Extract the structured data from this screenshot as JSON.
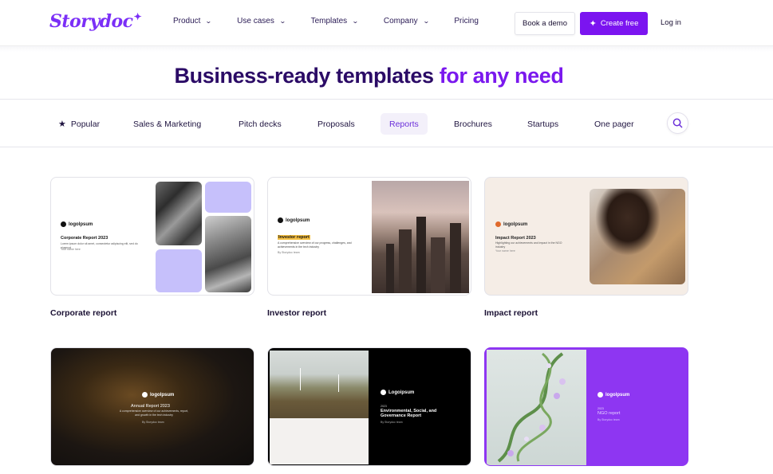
{
  "nav": {
    "logo": "Storydoc",
    "menu": [
      {
        "label": "Product",
        "has_dropdown": true
      },
      {
        "label": "Use cases",
        "has_dropdown": true
      },
      {
        "label": "Templates",
        "has_dropdown": true
      },
      {
        "label": "Company",
        "has_dropdown": true
      },
      {
        "label": "Pricing",
        "has_dropdown": false
      }
    ],
    "book_demo": "Book a demo",
    "create_free": "Create free",
    "login": "Log in"
  },
  "headline": {
    "main": "Business-ready templates ",
    "accent": "for any need"
  },
  "categories": [
    {
      "label": "Popular",
      "icon": "star-icon",
      "active": false
    },
    {
      "label": "Sales & Marketing",
      "active": false
    },
    {
      "label": "Pitch decks",
      "active": false
    },
    {
      "label": "Proposals",
      "active": false
    },
    {
      "label": "Reports",
      "active": true
    },
    {
      "label": "Brochures",
      "active": false
    },
    {
      "label": "Startups",
      "active": false
    },
    {
      "label": "One pager",
      "active": false
    }
  ],
  "search_icon": "search-icon",
  "templates": [
    {
      "title": "Corporate report",
      "preview": {
        "logo": "logolpsum",
        "heading": "Corporate Report 2023",
        "body": "Lorem ipsum dolor sit amet, consectetur adipiscing elit, sed do eiusmod",
        "meta": "Your name here"
      }
    },
    {
      "title": "Investor report",
      "preview": {
        "logo": "logolpsum",
        "heading": "Investor report",
        "body": "A comprehensive overview of our progress, challenges, and achievements in the tech industry",
        "meta": "By Storydoc team"
      }
    },
    {
      "title": "Impact report",
      "preview": {
        "logo": "logolpsum",
        "heading": "Impact Report 2023",
        "body": "Highlighting our achievements and impact in the NGO industry",
        "meta": "Your name here"
      }
    },
    {
      "title": "",
      "preview": {
        "logo": "logolpsum",
        "heading": "Annual Report 2023",
        "body": "A comprehensive overview of our achievements, report, and growth in the tech industry",
        "meta": "By Storydoc team"
      }
    },
    {
      "title": "",
      "preview": {
        "logo": "Logoipsum",
        "year": "2023",
        "heading": "Environmental, Social, and Governance Report",
        "meta": "By Storydoc team"
      }
    },
    {
      "title": "",
      "preview": {
        "logo": "logolpsum",
        "year": "2023",
        "heading": "NGO report",
        "meta": "By Storydoc team"
      }
    }
  ],
  "colors": {
    "brand": "#7b14f0",
    "headline": "#2b0b66",
    "accent": "#7a18ee",
    "active_tab_bg": "#f3f0fa",
    "lavender": "#c6c0fb"
  }
}
